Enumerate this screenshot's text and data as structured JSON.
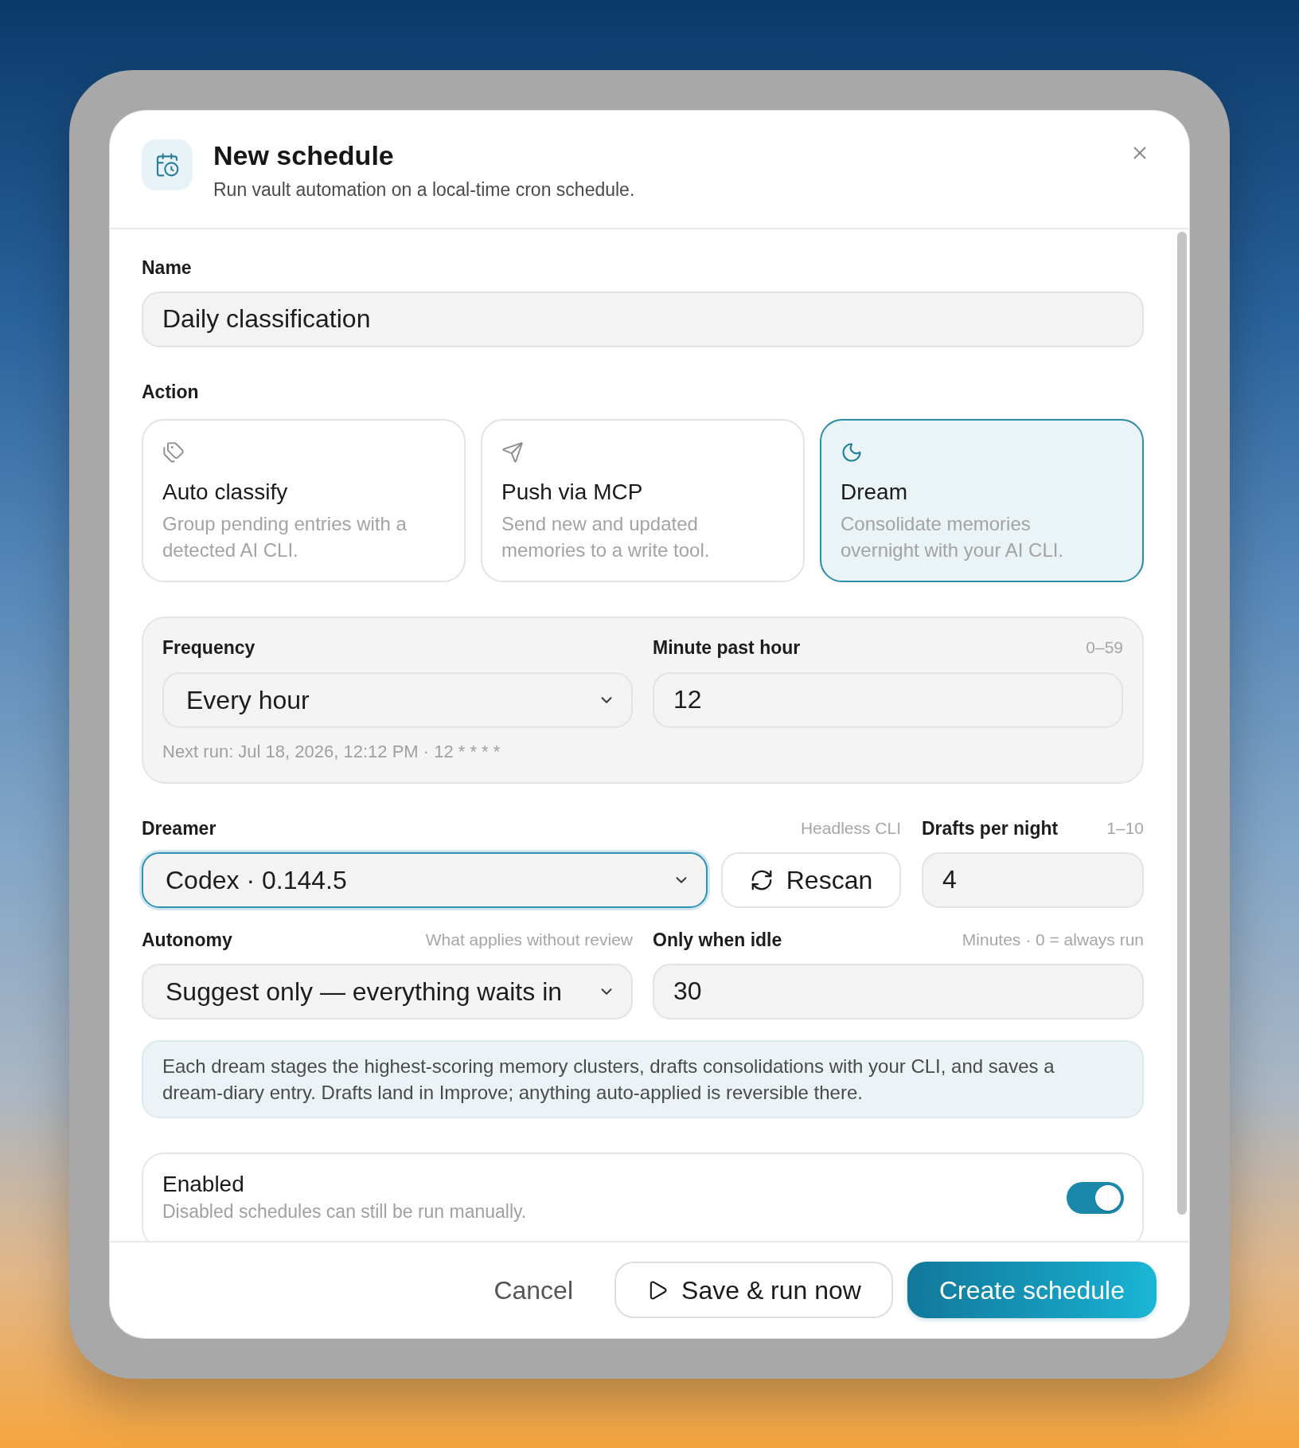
{
  "dialog": {
    "title": "New schedule",
    "subtitle": "Run vault automation on a local-time cron schedule."
  },
  "name": {
    "label": "Name",
    "value": "Daily classification"
  },
  "action": {
    "label": "Action",
    "options": [
      {
        "kind": "classify",
        "title": "Auto classify",
        "description": "Group pending entries with a detected AI CLI.",
        "selected": false
      },
      {
        "kind": "push",
        "title": "Push via MCP",
        "description": "Send new and updated memories to a write tool.",
        "selected": false
      },
      {
        "kind": "dream",
        "title": "Dream",
        "description": "Consolidate memories overnight with your AI CLI.",
        "selected": true
      }
    ]
  },
  "timing": {
    "frequency": {
      "label": "Frequency",
      "value": "Every hour"
    },
    "minute": {
      "label": "Minute past hour",
      "hint": "0–59",
      "value": "12"
    },
    "next_run": "Next run: Jul 18, 2026, 12:12 PM · 12 * * * *"
  },
  "dreamer": {
    "label": "Dreamer",
    "hint": "Headless CLI",
    "value": "Codex · 0.144.5",
    "focused": true
  },
  "rescan_button": "Rescan",
  "drafts": {
    "label": "Drafts per night",
    "hint": "1–10",
    "value": "4"
  },
  "autonomy": {
    "label": "Autonomy",
    "hint": "What applies without review",
    "value": "Suggest only — everything waits in"
  },
  "idle": {
    "label": "Only when idle",
    "hint": "Minutes · 0 = always run",
    "value": "30"
  },
  "info": "Each dream stages the highest-scoring memory clusters, drafts consolidations with your CLI, and saves a dream-diary entry. Drafts land in Improve; anything auto-applied is reversible there.",
  "enabled": {
    "label": "Enabled",
    "description": "Disabled schedules can still be run manually.",
    "on": true
  },
  "footer": {
    "buttons": [
      {
        "kind": "ghost",
        "label": "Cancel"
      },
      {
        "kind": "outline",
        "label": "Save & run now"
      },
      {
        "kind": "primary",
        "label": "Create schedule"
      }
    ]
  }
}
